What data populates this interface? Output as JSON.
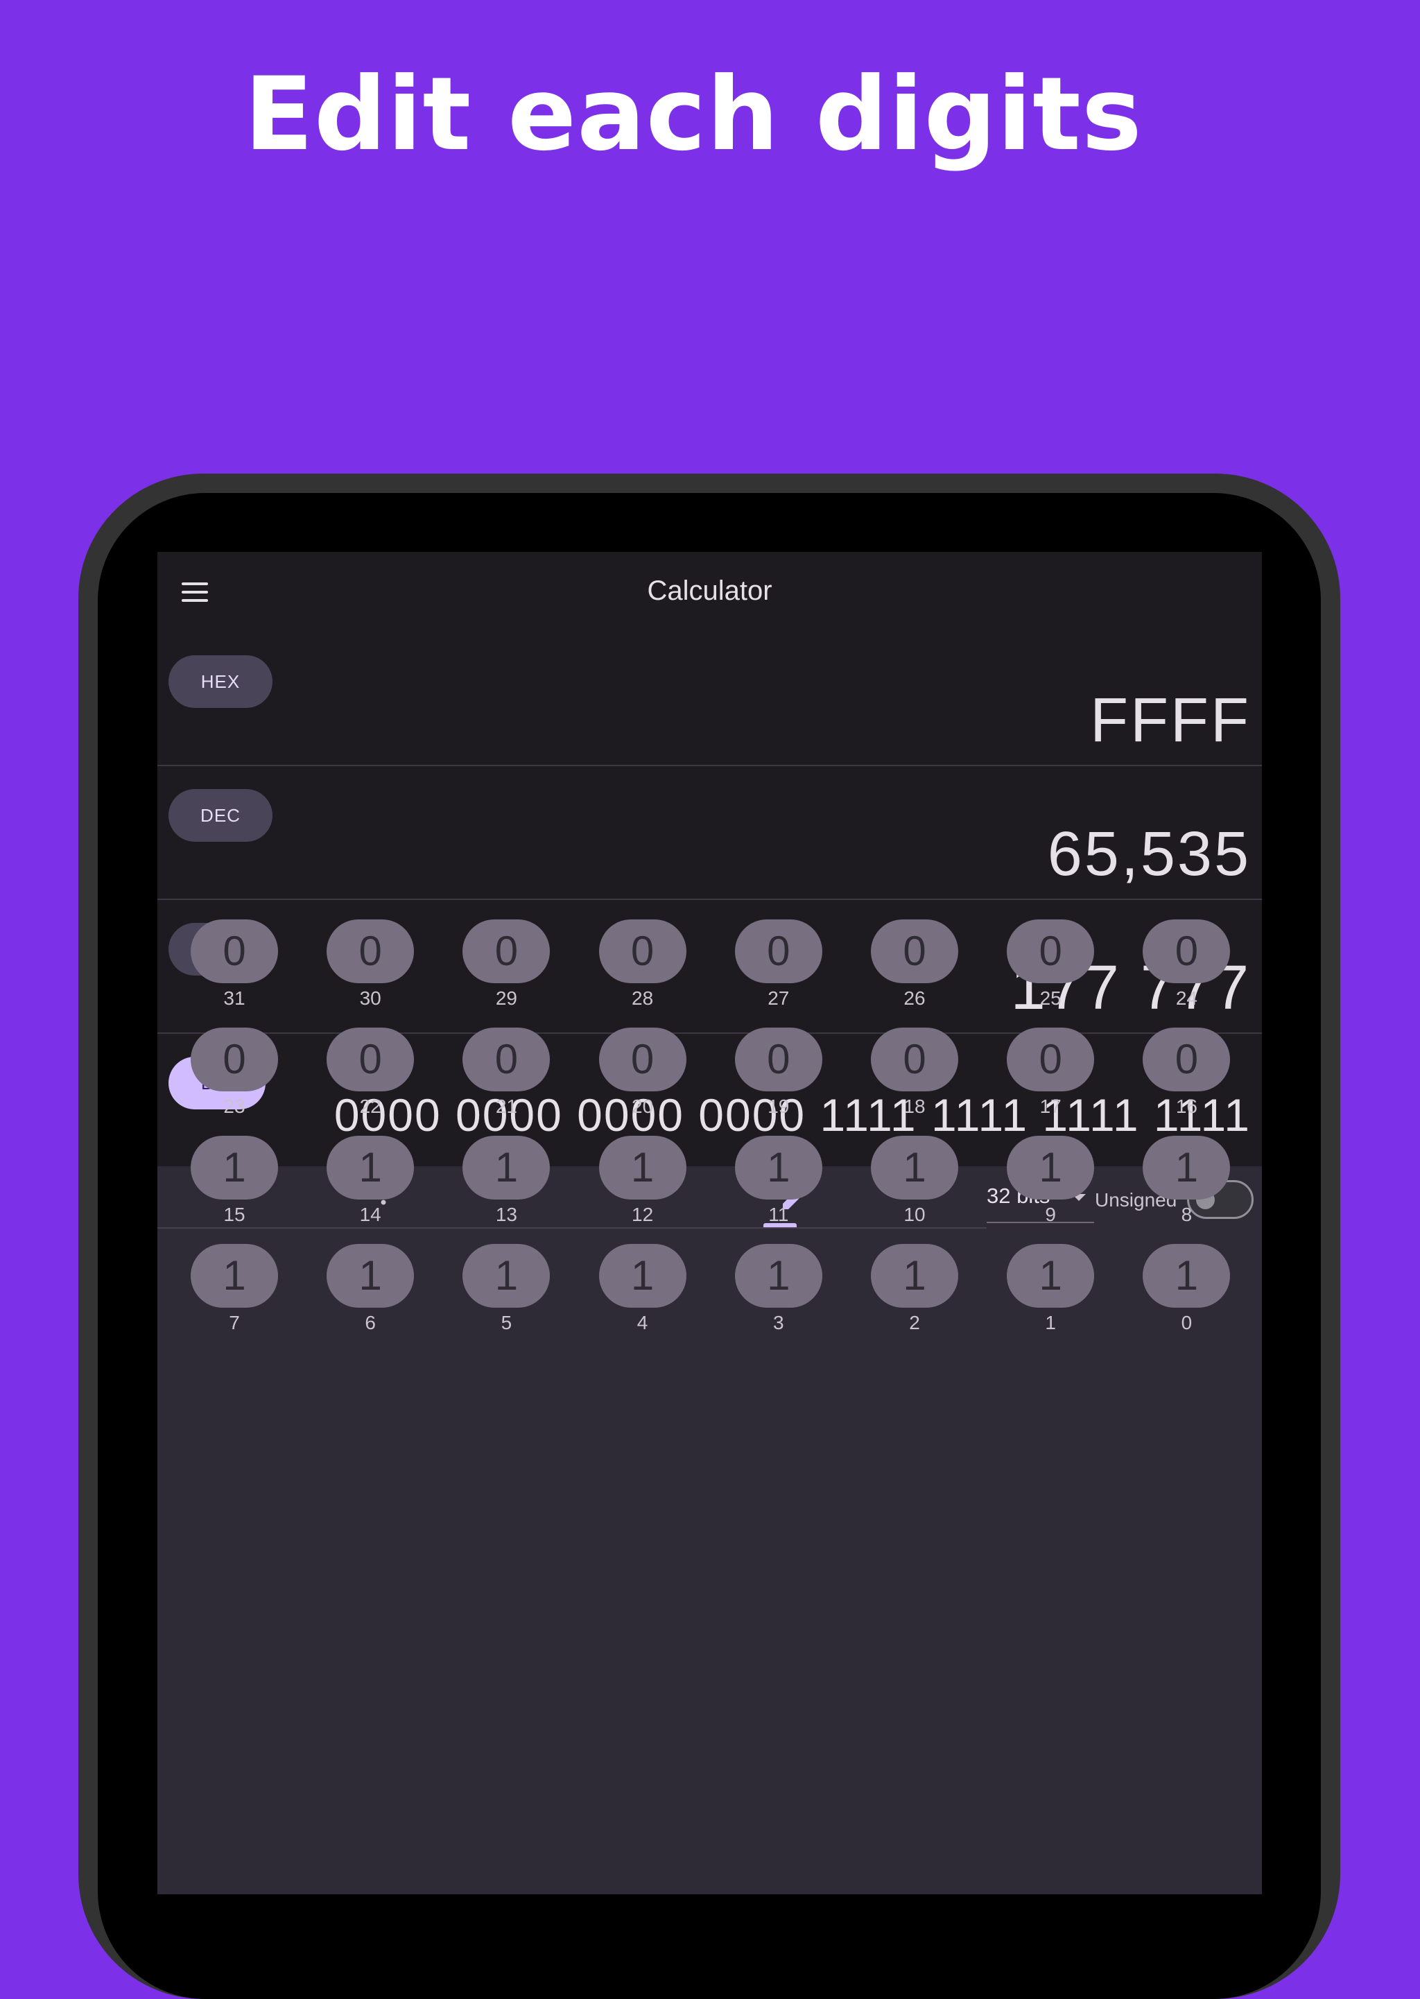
{
  "headline": "Edit each digits",
  "app": {
    "title": "Calculator",
    "menu_icon": "hamburger-menu-icon"
  },
  "bases": [
    {
      "label": "HEX",
      "value": "FFFF",
      "active": false
    },
    {
      "label": "DEC",
      "value": "65,535",
      "active": false
    },
    {
      "label": "OCT",
      "value": "177 777",
      "active": false
    },
    {
      "label": "BIN",
      "value": "0000 0000 0000 0000 1111 1111 1111 1111",
      "active": true
    }
  ],
  "toolbar": {
    "tabs": [
      {
        "icon": "dialpad-icon",
        "selected": false
      },
      {
        "icon": "pencil-edit-icon",
        "selected": true
      }
    ],
    "bits_value": "32 bits",
    "unsigned_label": "Unsigned",
    "unsigned_on": false
  },
  "colors": {
    "background": "#7c31e8",
    "accent": "#d0bcff",
    "surface": "#1d1b20"
  },
  "bit_rows": [
    [
      {
        "value": "0",
        "index": "31"
      },
      {
        "value": "0",
        "index": "30"
      },
      {
        "value": "0",
        "index": "29"
      },
      {
        "value": "0",
        "index": "28"
      },
      {
        "value": "0",
        "index": "27"
      },
      {
        "value": "0",
        "index": "26"
      },
      {
        "value": "0",
        "index": "25"
      },
      {
        "value": "0",
        "index": "24"
      }
    ],
    [
      {
        "value": "0",
        "index": "23"
      },
      {
        "value": "0",
        "index": "22"
      },
      {
        "value": "0",
        "index": "21"
      },
      {
        "value": "0",
        "index": "20"
      },
      {
        "value": "0",
        "index": "19"
      },
      {
        "value": "0",
        "index": "18"
      },
      {
        "value": "0",
        "index": "17"
      },
      {
        "value": "0",
        "index": "16"
      }
    ],
    [
      {
        "value": "1",
        "index": "15"
      },
      {
        "value": "1",
        "index": "14"
      },
      {
        "value": "1",
        "index": "13"
      },
      {
        "value": "1",
        "index": "12"
      },
      {
        "value": "1",
        "index": "11"
      },
      {
        "value": "1",
        "index": "10"
      },
      {
        "value": "1",
        "index": "9"
      },
      {
        "value": "1",
        "index": "8"
      }
    ],
    [
      {
        "value": "1",
        "index": "7"
      },
      {
        "value": "1",
        "index": "6"
      },
      {
        "value": "1",
        "index": "5"
      },
      {
        "value": "1",
        "index": "4"
      },
      {
        "value": "1",
        "index": "3"
      },
      {
        "value": "1",
        "index": "2"
      },
      {
        "value": "1",
        "index": "1"
      },
      {
        "value": "1",
        "index": "0"
      }
    ]
  ]
}
